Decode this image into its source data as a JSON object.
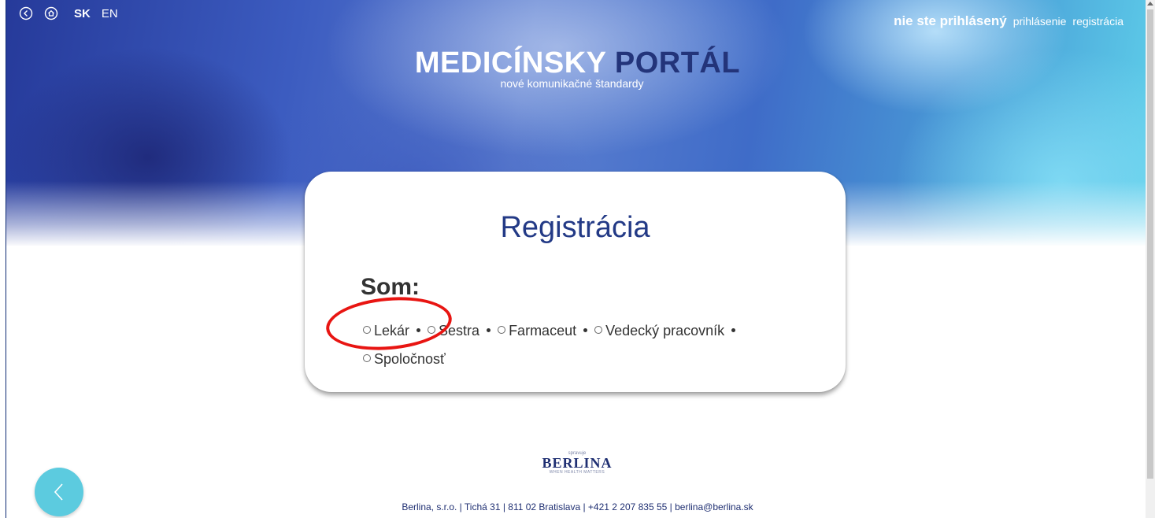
{
  "topbar": {
    "back_icon": "circle-arrow-left-icon",
    "home_icon": "circle-home-icon",
    "languages": [
      "SK",
      "EN"
    ],
    "active_language": "SK",
    "status": "nie ste prihlásený",
    "links": [
      "prihlásenie",
      "registrácia"
    ]
  },
  "logo": {
    "title_part1": "MEDICÍNSKY",
    "title_part2": "PORTÁL",
    "subtitle": "nové komunikačné štandardy"
  },
  "card": {
    "title": "Registrácia",
    "label": "Som:",
    "options": [
      "Lekár",
      "Sestra",
      "Farmaceut",
      "Vedecký pracovník",
      "Spoločnosť"
    ]
  },
  "footer": {
    "logo_small": "spravuje",
    "logo_name": "BERLINA",
    "logo_tagline": "WHEN HEALTH MATTERS",
    "address": "Berlina, s.r.o. | Tichá 31 | 811 02 Bratislava | +421 2 207 835 55 | berlina@berlina.sk"
  },
  "floating": {
    "back_icon": "chevron-left-icon"
  },
  "colors": {
    "accent_dark": "#233a86",
    "floating_button": "#5ccbdf",
    "annotation": "#e81512"
  }
}
